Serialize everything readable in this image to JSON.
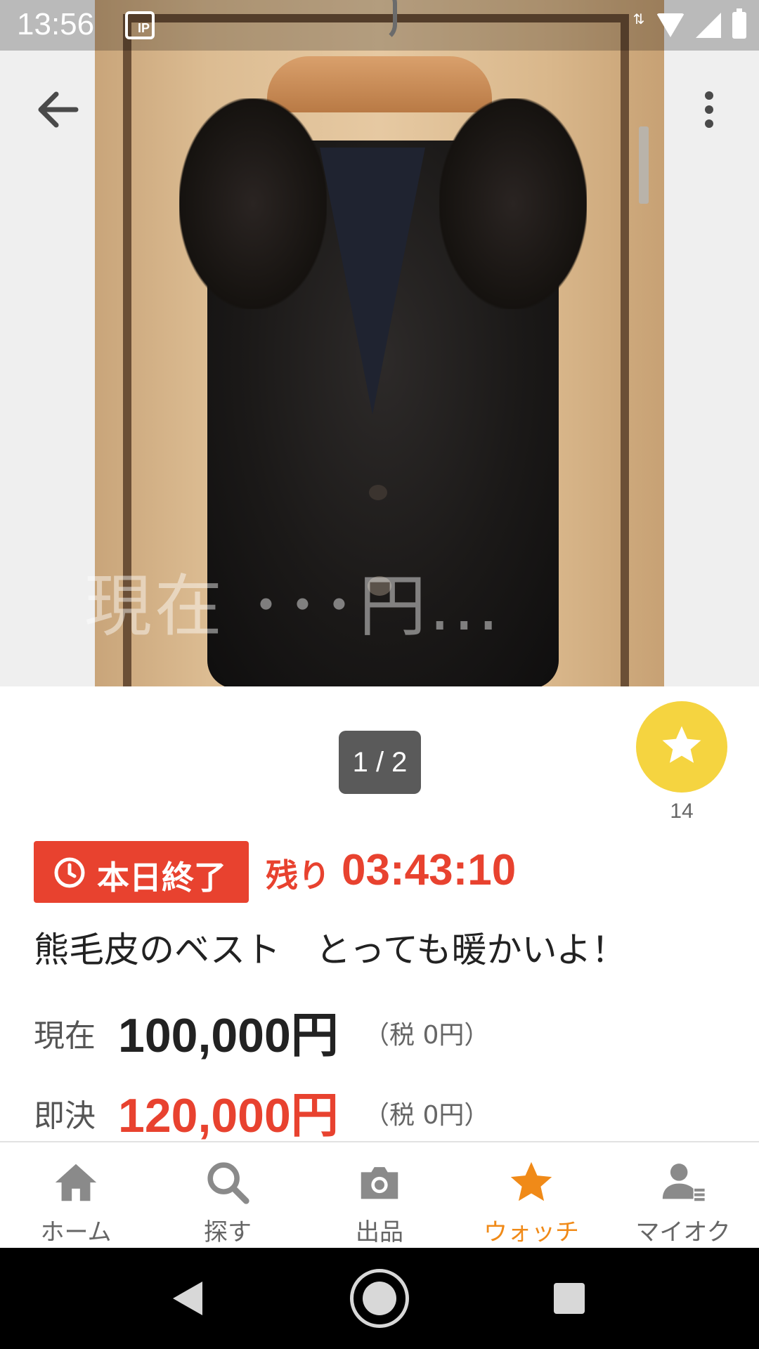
{
  "status_bar": {
    "time": "13:56",
    "ip_badge": "IP",
    "network": "4",
    "icons": [
      "data-arrows-icon",
      "wifi-icon",
      "cell-signal-icon",
      "battery-icon"
    ]
  },
  "toolbar": {
    "back_icon": "arrow-back-icon",
    "more_icon": "more-vert-icon"
  },
  "image_viewer": {
    "watermark": "現在 ･･･円...",
    "counter": "1 / 2"
  },
  "watch": {
    "icon": "star-icon",
    "count": "14"
  },
  "auction": {
    "end_badge": "本日終了",
    "remaining_label": "残り",
    "remaining_time": "03:43:10",
    "title": "熊毛皮のベスト　とっても暖かいよ！"
  },
  "prices": {
    "current": {
      "label": "現在",
      "value": "100,000円",
      "tax": "（税 0円）"
    },
    "buyout": {
      "label": "即決",
      "value": "120,000円",
      "tax": "（税 0円）"
    }
  },
  "tabs": [
    {
      "label": "ホーム",
      "icon": "home-icon",
      "active": false
    },
    {
      "label": "探す",
      "icon": "search-icon",
      "active": false
    },
    {
      "label": "出品",
      "icon": "camera-icon",
      "active": false
    },
    {
      "label": "ウォッチ",
      "icon": "star-icon",
      "active": true
    },
    {
      "label": "マイオク",
      "icon": "account-icon",
      "active": false
    }
  ],
  "colors": {
    "accent_red": "#e8422f",
    "watch_yellow": "#f5d440",
    "active_tab_orange": "#f08a18"
  }
}
